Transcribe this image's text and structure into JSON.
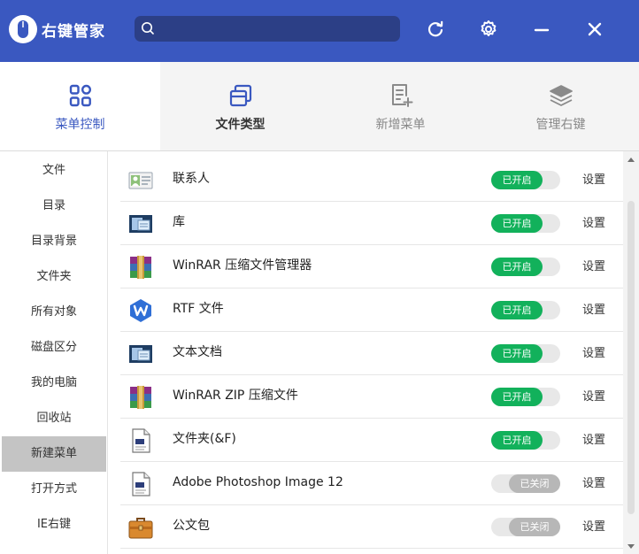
{
  "app": {
    "title": "右键管家",
    "accent": "#3a58c0"
  },
  "search": {
    "value": "",
    "placeholder": "",
    "icon": "search-icon"
  },
  "titlebar_buttons": [
    {
      "name": "refresh-icon"
    },
    {
      "name": "gear-icon"
    },
    {
      "name": "minimize-icon"
    },
    {
      "name": "close-icon"
    }
  ],
  "tabs": [
    {
      "label": "菜单控制",
      "icon": "grid-icon",
      "active": true
    },
    {
      "label": "文件类型",
      "icon": "file-type-icon",
      "active": false
    },
    {
      "label": "新增菜单",
      "icon": "add-document-icon",
      "active": false
    },
    {
      "label": "管理右键",
      "icon": "layers-icon",
      "active": false
    }
  ],
  "sidebar": {
    "items": [
      {
        "label": "文件"
      },
      {
        "label": "目录"
      },
      {
        "label": "目录背景"
      },
      {
        "label": "文件夹"
      },
      {
        "label": "所有对象"
      },
      {
        "label": "磁盘区分"
      },
      {
        "label": "我的电脑"
      },
      {
        "label": "回收站"
      },
      {
        "label": "新建菜单",
        "selected": true
      },
      {
        "label": "打开方式"
      },
      {
        "label": "IE右键"
      }
    ]
  },
  "list": {
    "rows": [
      {
        "name": "联系人",
        "icon": "contact-card-icon",
        "status": "已开启",
        "on": true,
        "action": "设置"
      },
      {
        "name": "库",
        "icon": "library-icon",
        "status": "已开启",
        "on": true,
        "action": "设置"
      },
      {
        "name": "WinRAR 压缩文件管理器",
        "icon": "winrar-icon",
        "status": "已开启",
        "on": true,
        "action": "设置"
      },
      {
        "name": "RTF 文件",
        "icon": "wps-icon",
        "status": "已开启",
        "on": true,
        "action": "设置"
      },
      {
        "name": "文本文档",
        "icon": "library-icon",
        "status": "已开启",
        "on": true,
        "action": "设置"
      },
      {
        "name": "WinRAR ZIP 压缩文件",
        "icon": "winrar-icon",
        "status": "已开启",
        "on": true,
        "action": "设置"
      },
      {
        "name": "文件夹(&F)",
        "icon": "document-icon",
        "status": "已开启",
        "on": true,
        "action": "设置"
      },
      {
        "name": "Adobe Photoshop Image 12",
        "icon": "document-icon",
        "status": "已关闭",
        "on": false,
        "action": "设置"
      },
      {
        "name": "公文包",
        "icon": "briefcase-icon",
        "status": "已关闭",
        "on": false,
        "action": "设置"
      }
    ]
  },
  "colors": {
    "on": "#12b15b",
    "off": "#b7b7b7",
    "titlebar": "#3a58c0"
  }
}
